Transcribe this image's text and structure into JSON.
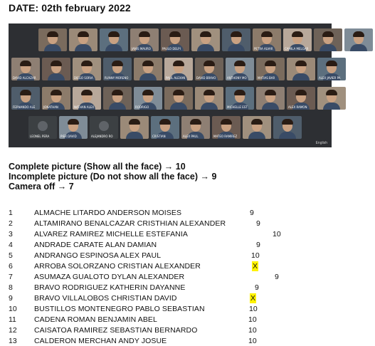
{
  "date": "DATE: 02th february 2022",
  "legend": [
    "Complete picture (Show all the face) → 10",
    "Incomplete picture (Do not show all the face) → 9",
    "Camera off → 7"
  ],
  "grid": {
    "rows": [
      [
        {
          "label": "",
          "camera": true
        },
        {
          "label": "",
          "camera": true
        },
        {
          "label": "",
          "camera": true
        },
        {
          "label": "JANIS MAURO",
          "camera": true
        },
        {
          "label": "PAULO DELPI",
          "camera": true
        },
        {
          "label": "",
          "camera": true
        },
        {
          "label": "",
          "camera": true
        },
        {
          "label": "PETRA ALVAR",
          "camera": true
        },
        {
          "label": "CAMILA MELGAR",
          "camera": true
        },
        {
          "label": "",
          "camera": true
        },
        {
          "label": "",
          "camera": true
        }
      ],
      [
        {
          "label": "DAVID ALCAZAR",
          "camera": true
        },
        {
          "label": "",
          "camera": true
        },
        {
          "label": "DIEGO SORIA",
          "camera": true
        },
        {
          "label": "RUNNY MORENO",
          "camera": true
        },
        {
          "label": "",
          "camera": true
        },
        {
          "label": "PAUL ALEXAN",
          "camera": true
        },
        {
          "label": "DAVID BRAVO",
          "camera": true
        },
        {
          "label": "ANTHONY MO",
          "camera": true
        },
        {
          "label": "MATIAS BAR",
          "camera": true
        },
        {
          "label": "",
          "camera": true
        },
        {
          "label": "ALEX JAVIER PA",
          "camera": true
        }
      ],
      [
        {
          "label": "FERNANDO ALE",
          "camera": true
        },
        {
          "label": "JONATHAN",
          "camera": true
        },
        {
          "label": "NATHAN ALEX",
          "camera": true
        },
        {
          "label": "",
          "camera": true
        },
        {
          "label": "RODRIGO",
          "camera": true
        },
        {
          "label": "",
          "camera": true
        },
        {
          "label": "",
          "camera": true
        },
        {
          "label": "MICHELLE EST",
          "camera": true
        },
        {
          "label": "",
          "camera": true
        },
        {
          "label": "ALEX RAMON",
          "camera": true
        },
        {
          "label": "",
          "camera": true
        }
      ],
      [
        {
          "label": "LEONEL PERA",
          "camera": false
        },
        {
          "label": "PIER DAVID",
          "camera": true
        },
        {
          "label": "ALEJANDRO RO",
          "camera": false
        },
        {
          "label": "",
          "camera": true
        },
        {
          "label": "CRISTIAN",
          "camera": true
        },
        {
          "label": "ALEX PAUL",
          "camera": true
        },
        {
          "label": "MATEO RAMIREZ",
          "camera": true
        },
        {
          "label": "",
          "camera": true
        },
        {
          "label": "",
          "camera": true
        }
      ]
    ],
    "caption_label": "English"
  },
  "students": [
    {
      "num": "1",
      "name": "ALMACHE LITARDO ANDERSON MOISES",
      "score": "9",
      "highlight": false
    },
    {
      "num": "2",
      "name": "ALTAMIRANO BENALCAZAR CRISTHIAN ALEXANDER",
      "score": "9",
      "highlight": false
    },
    {
      "num": "3",
      "name": "ALVAREZ RAMIREZ MICHELLE ESTEFANIA",
      "score": "10",
      "highlight": false
    },
    {
      "num": "4",
      "name": "ANDRADE CARATE ALAN DAMIAN",
      "score": "9",
      "highlight": false
    },
    {
      "num": "5",
      "name": "ANDRANGO ESPINOSA ALEX PAUL",
      "score": "10",
      "highlight": false
    },
    {
      "num": "6",
      "name": "ARROBA SOLORZANO CRISTIAN ALEXANDER",
      "score": "X",
      "highlight": true
    },
    {
      "num": "7",
      "name": "ASUMAZA GUALOTO DYLAN ALEXANDER",
      "score": "9",
      "highlight": false
    },
    {
      "num": "8",
      "name": "BRAVO RODRIGUEZ KATHERIN DAYANNE",
      "score": "9",
      "highlight": false
    },
    {
      "num": "9",
      "name": "BRAVO VILLALOBOS CHRISTIAN DAVID",
      "score": "X",
      "highlight": true
    },
    {
      "num": "10",
      "name": "BUSTILLOS MONTENEGRO PABLO SEBASTIAN",
      "score": "10",
      "highlight": false
    },
    {
      "num": "11",
      "name": "CADENA ROMAN BENJAMIN ABEL",
      "score": "10",
      "highlight": false
    },
    {
      "num": "12",
      "name": "CAISATOA RAMIREZ SEBASTIAN BERNARDO",
      "score": "10",
      "highlight": false
    },
    {
      "num": "13",
      "name": "CALDERON MERCHAN ANDY JOSUE",
      "score": "10",
      "highlight": false
    }
  ]
}
